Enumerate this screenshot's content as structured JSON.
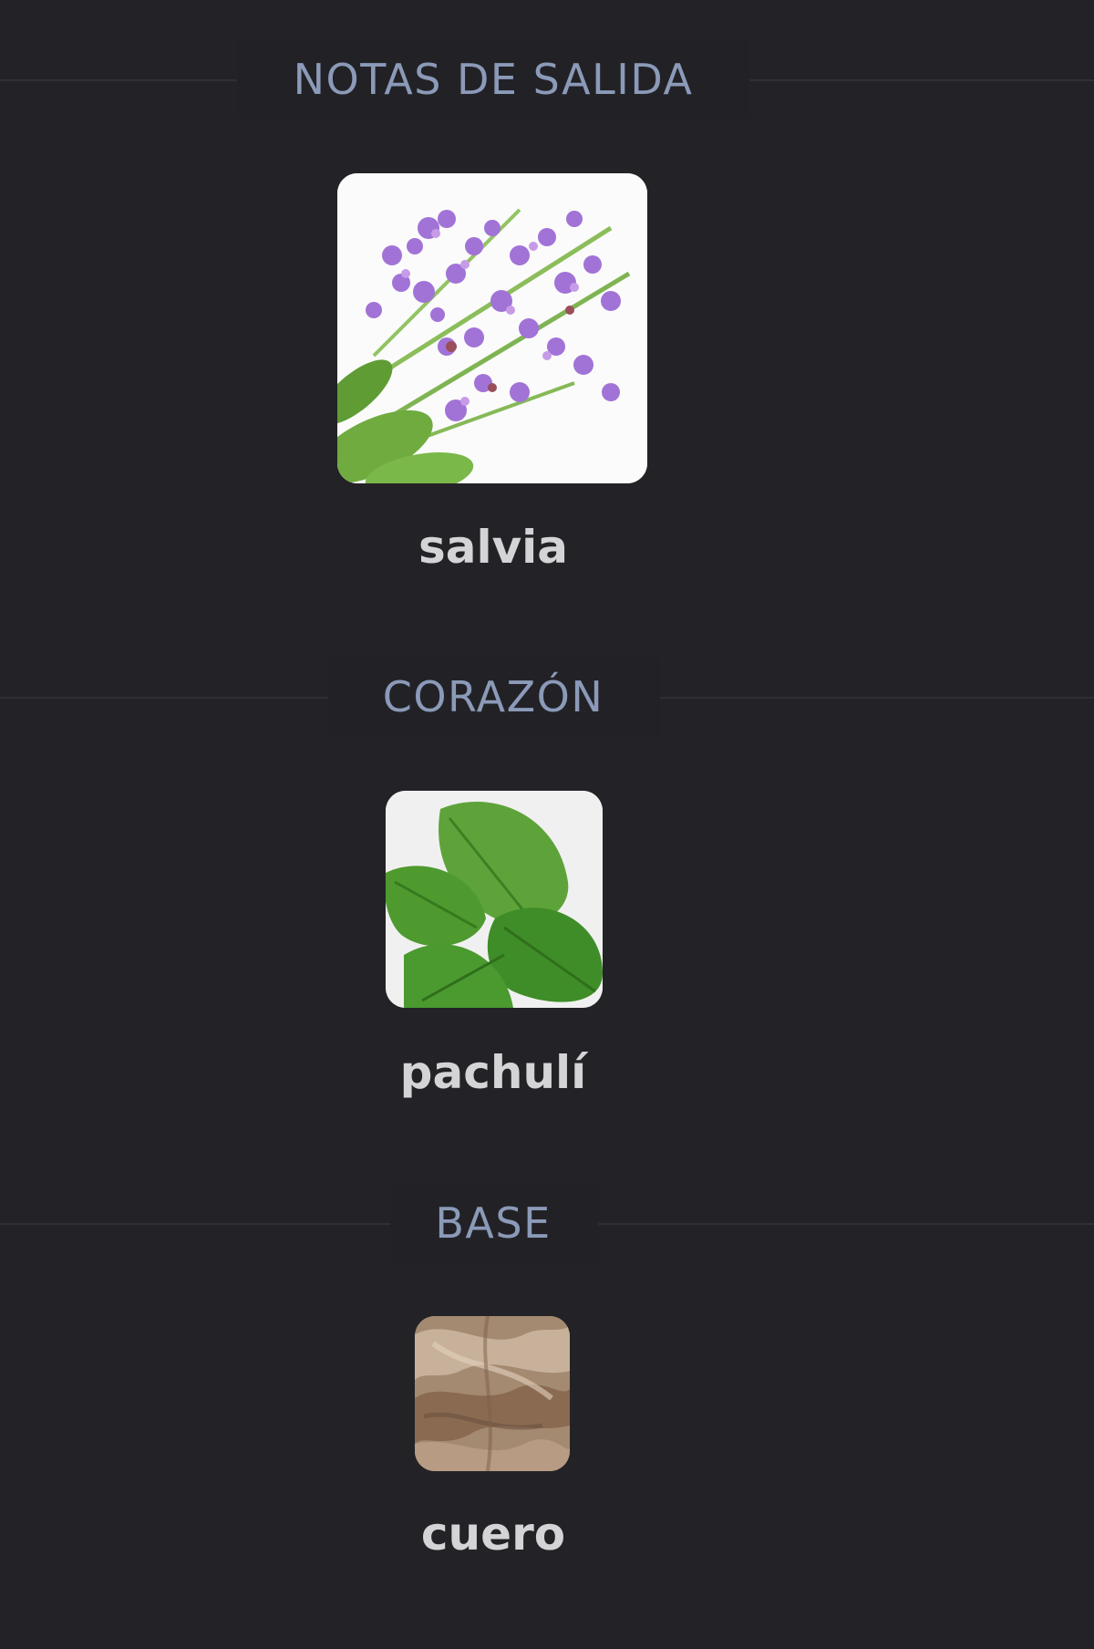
{
  "sections": [
    {
      "title": "NOTAS DE SALIDA",
      "notes": [
        {
          "name": "salvia",
          "icon": "sage-flowers-image"
        }
      ]
    },
    {
      "title": "CORAZÓN",
      "notes": [
        {
          "name": "pachulí",
          "icon": "patchouli-leaves-image"
        }
      ]
    },
    {
      "title": "BASE",
      "notes": [
        {
          "name": "cuero",
          "icon": "leather-texture-image"
        }
      ]
    }
  ],
  "colors": {
    "background": "#232327",
    "section_title": "#8b9ab8",
    "note_name": "#d4d4d6",
    "divider": "#2f3036"
  }
}
